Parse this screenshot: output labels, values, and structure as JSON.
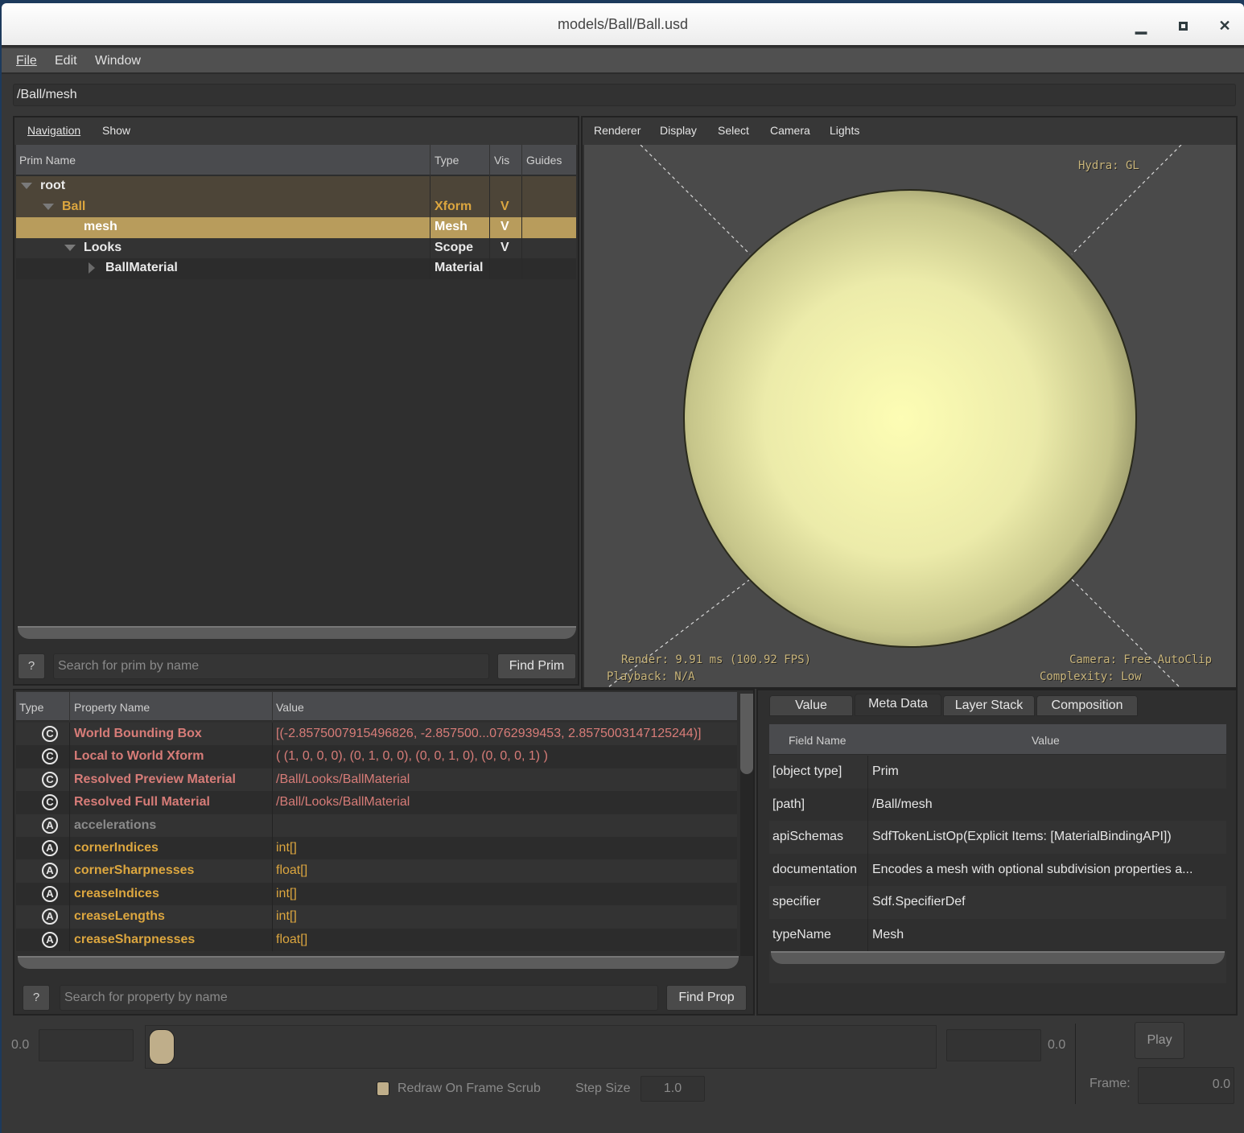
{
  "window": {
    "title": "models/Ball/Ball.usd",
    "controls": [
      "minimize",
      "maximize",
      "close"
    ]
  },
  "menubar": {
    "items": [
      "File",
      "Edit",
      "Window"
    ]
  },
  "path_bar": {
    "value": "/Ball/mesh"
  },
  "prim_panel": {
    "menu": [
      "Navigation",
      "Show"
    ],
    "columns": [
      "Prim Name",
      "Type",
      "Vis",
      "Guides"
    ],
    "rows": [
      {
        "name": "root",
        "type": "",
        "vis": "",
        "guides": "",
        "expanded": true,
        "depth": 0
      },
      {
        "name": "Ball",
        "type": "Xform",
        "vis": "V",
        "guides": "",
        "expanded": true,
        "depth": 1
      },
      {
        "name": "mesh",
        "type": "Mesh",
        "vis": "V",
        "guides": "",
        "selected": true,
        "depth": 2
      },
      {
        "name": "Looks",
        "type": "Scope",
        "vis": "V",
        "guides": "",
        "expanded": true,
        "depth": 2
      },
      {
        "name": "BallMaterial",
        "type": "Material",
        "vis": "",
        "guides": "",
        "expanded": false,
        "depth": 3
      }
    ],
    "help_label": "?",
    "search_placeholder": "Search for prim by name",
    "find_label": "Find Prim"
  },
  "viewport": {
    "menu": [
      "Renderer",
      "Display",
      "Select",
      "Camera",
      "Lights"
    ],
    "hud_renderer": "Hydra: GL",
    "hud_render": "Render: 9.91 ms (100.92 FPS)",
    "hud_playback": "Playback: N/A",
    "hud_camera": "Camera: Free AutoClip",
    "hud_complexity": "Complexity: Low",
    "sphere_color": "#fdfdb4"
  },
  "property_panel": {
    "columns": [
      "Type",
      "Property Name",
      "Value"
    ],
    "rows": [
      {
        "type_icon": "C",
        "name": "World Bounding Box",
        "value": "[(-2.8575007915496826, -2.857500...0762939453, 2.8575003147125244)]",
        "kind": "computed"
      },
      {
        "type_icon": "C",
        "name": "Local to World Xform",
        "value": "( (1, 0, 0, 0), (0, 1, 0, 0), (0, 0, 1, 0), (0, 0, 0, 1) )",
        "kind": "computed"
      },
      {
        "type_icon": "C",
        "name": "Resolved Preview Material",
        "value": "/Ball/Looks/BallMaterial",
        "kind": "computed"
      },
      {
        "type_icon": "C",
        "name": "Resolved Full Material",
        "value": "/Ball/Looks/BallMaterial",
        "kind": "computed"
      },
      {
        "type_icon": "A",
        "name": "accelerations",
        "value": "",
        "kind": "fallback"
      },
      {
        "type_icon": "A",
        "name": "cornerIndices",
        "value": "int[]",
        "kind": "authored"
      },
      {
        "type_icon": "A",
        "name": "cornerSharpnesses",
        "value": "float[]",
        "kind": "authored"
      },
      {
        "type_icon": "A",
        "name": "creaseIndices",
        "value": "int[]",
        "kind": "authored"
      },
      {
        "type_icon": "A",
        "name": "creaseLengths",
        "value": "int[]",
        "kind": "authored"
      },
      {
        "type_icon": "A",
        "name": "creaseSharpnesses",
        "value": "float[]",
        "kind": "authored"
      }
    ],
    "help_label": "?",
    "search_placeholder": "Search for property by name",
    "find_label": "Find Prop",
    "colors": {
      "computed": "#d77c78",
      "authored": "#dca63f",
      "fallback": "#8a8a8a"
    }
  },
  "metadata_panel": {
    "tabs": [
      "Value",
      "Meta Data",
      "Layer Stack",
      "Composition"
    ],
    "active_tab": "Meta Data",
    "columns": [
      "Field Name",
      "Value"
    ],
    "rows": [
      {
        "field": "[object type]",
        "value": "Prim"
      },
      {
        "field": "[path]",
        "value": "/Ball/mesh"
      },
      {
        "field": "apiSchemas",
        "value": "SdfTokenListOp(Explicit Items: [MaterialBindingAPI])"
      },
      {
        "field": "documentation",
        "value": "Encodes a mesh with optional subdivision properties a..."
      },
      {
        "field": "specifier",
        "value": "Sdf.SpecifierDef"
      },
      {
        "field": "typeName",
        "value": "Mesh"
      }
    ]
  },
  "timeline": {
    "start_label": "0.0",
    "end_label": "0.0",
    "start_value": "",
    "end_value": "",
    "slider_position": 0,
    "redraw_label": "Redraw On Frame Scrub",
    "redraw_checked": false,
    "step_size_label": "Step Size",
    "step_size_value": "1.0",
    "play_label": "Play",
    "frame_label": "Frame:",
    "frame_value": "0.0"
  }
}
